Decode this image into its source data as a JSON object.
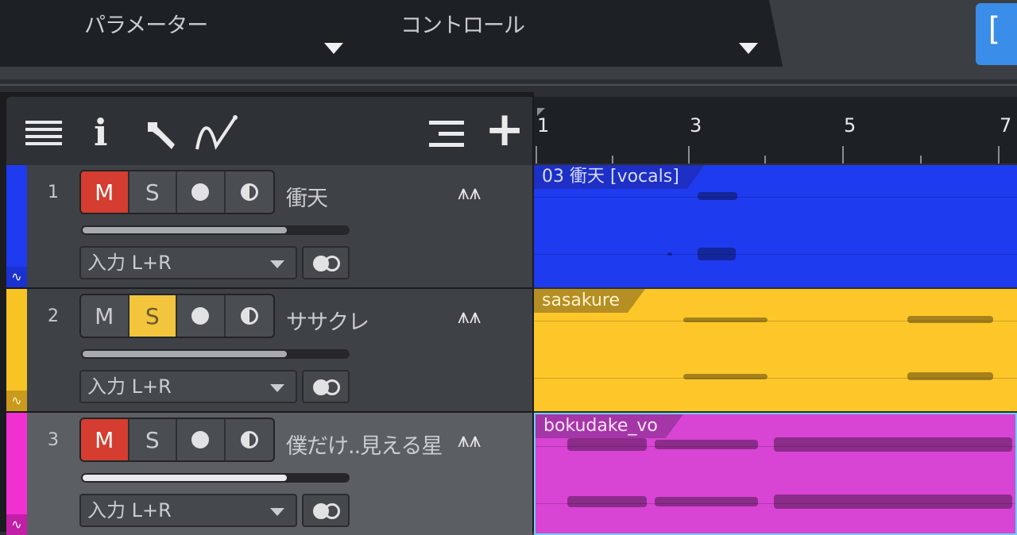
{
  "header": {
    "parameter_label": "パラメーター",
    "control_label": "コントロール",
    "blue_button_glyph": "["
  },
  "toolbar": {
    "icons": [
      "list-icon",
      "info-icon",
      "wrench-icon",
      "automation-icon",
      "track-list-icon",
      "add-icon"
    ],
    "info_glyph": "i",
    "add_glyph": "+"
  },
  "tracks": [
    {
      "number": "1",
      "name": "衝天",
      "color": "#1f3bf0",
      "mute": "M",
      "solo": "S",
      "mute_on": true,
      "solo_on": false,
      "input": "入力 L+R",
      "fader_level": 0.77,
      "selected": false
    },
    {
      "number": "2",
      "name": "ササクレ",
      "color": "#f7c325",
      "mute": "M",
      "solo": "S",
      "mute_on": false,
      "solo_on": true,
      "input": "入力 L+R",
      "fader_level": 0.77,
      "selected": false
    },
    {
      "number": "3",
      "name": "僕だけ..見える星",
      "color": "#f22fcf",
      "mute": "M",
      "solo": "S",
      "mute_on": true,
      "solo_on": false,
      "input": "入力 L+R",
      "fader_level": 0.77,
      "selected": true
    }
  ],
  "ruler": {
    "bars": [
      "1",
      "3",
      "5",
      "7"
    ]
  },
  "clips": [
    {
      "label": "03 衝天 [vocals]",
      "color": "#1f3bf0",
      "label_bg": "#1d2fc4",
      "label_color": "#d6dcff"
    },
    {
      "label": "sasakure",
      "color": "#fdc72a",
      "label_bg": "#b58f24",
      "label_color": "#fff3cc"
    },
    {
      "label": "bokudake_vo",
      "color": "#d844d4",
      "label_bg": "#a436a8",
      "label_color": "#ffe3fb"
    }
  ],
  "colors": {
    "mute_on": "#d43d2f",
    "solo_on": "#f2c53d",
    "accent_blue": "#3a8de8"
  }
}
